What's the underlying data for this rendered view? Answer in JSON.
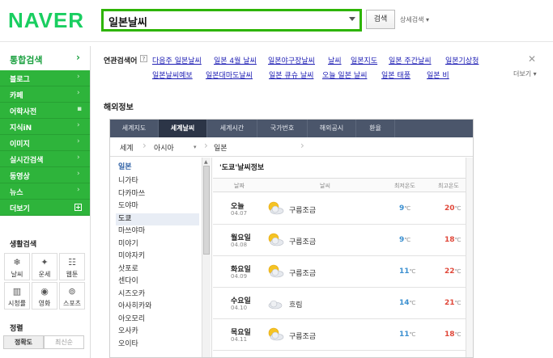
{
  "header": {
    "logo": "NAVER",
    "search_value": "일본날씨",
    "search_button": "검색",
    "detail_search": "상세검색 ▾"
  },
  "sidebar": {
    "top_label": "통합검색",
    "top_arrow": "›",
    "items": [
      {
        "label": "블로그",
        "icon": "chevron-right-icon"
      },
      {
        "label": "카페",
        "icon": "chevron-right-icon"
      },
      {
        "label": "어학사전",
        "icon": "dot-icon"
      },
      {
        "label": "지식iN",
        "icon": "chevron-right-icon"
      },
      {
        "label": "이미지",
        "icon": "chevron-right-icon"
      },
      {
        "label": "실시간검색",
        "icon": "chevron-right-icon"
      },
      {
        "label": "동영상",
        "icon": "chevron-right-icon"
      },
      {
        "label": "뉴스",
        "icon": "chevron-right-icon"
      },
      {
        "label": "더보기",
        "icon": "plus-box-icon"
      }
    ],
    "life_title": "생활검색",
    "life_items": [
      {
        "label": "날씨",
        "glyph": "❄"
      },
      {
        "label": "운세",
        "glyph": "✦"
      },
      {
        "label": "웹툰",
        "glyph": "☷"
      },
      {
        "label": "시청률",
        "glyph": "▥"
      },
      {
        "label": "영화",
        "glyph": "◉"
      },
      {
        "label": "스포츠",
        "glyph": "⊚"
      }
    ],
    "sort_title": "정렬",
    "sort_options": [
      "정확도",
      "최신순"
    ]
  },
  "related": {
    "title": "연관검색어",
    "help": "?",
    "row1": [
      "다음주 일본날씨",
      "일본 4월 날씨",
      "일본야구장날씨",
      "날씨",
      "일본지도",
      "일본 주간날씨",
      "일본기상청"
    ],
    "row2": [
      "일본날씨예보",
      "일본대마도날씨",
      "일본 큐슈 날씨",
      "오늘 일본 날씨",
      "일본 태풍",
      "일본 비"
    ],
    "close": "✕",
    "more": "더보기 ▾"
  },
  "overseas": {
    "section_title": "해외정보",
    "tabs": [
      "세계지도",
      "세계날씨",
      "세계시간",
      "국가번호",
      "해외공시",
      "환율"
    ],
    "active_tab": "세계날씨",
    "crumbs": [
      "세계",
      "아시아",
      "일본"
    ],
    "city_title": "일본",
    "cities": [
      "니가타",
      "다카마쓰",
      "도야마",
      "도쿄",
      "마쓰야마",
      "미야기",
      "미야자키",
      "삿포로",
      "센다이",
      "시즈오카",
      "아사히카와",
      "아오모리",
      "오사카",
      "오이타"
    ],
    "selected_city": "도쿄",
    "weather_title": "'도쿄'날씨정보",
    "weather_headers": [
      "날짜",
      "날씨",
      "최저온도",
      "최고온도"
    ],
    "forecast": [
      {
        "day": "오늘",
        "date": "04.07",
        "condition": "구름조금",
        "icon": "partly-cloudy-icon",
        "min": "9",
        "max": "20"
      },
      {
        "day": "월요일",
        "date": "04.08",
        "condition": "구름조금",
        "icon": "partly-cloudy-icon",
        "min": "9",
        "max": "18"
      },
      {
        "day": "화요일",
        "date": "04.09",
        "condition": "구름조금",
        "icon": "partly-cloudy-icon",
        "min": "11",
        "max": "22"
      },
      {
        "day": "수요일",
        "date": "04.10",
        "condition": "흐림",
        "icon": "cloudy-icon",
        "min": "14",
        "max": "21"
      },
      {
        "day": "목요일",
        "date": "04.11",
        "condition": "구름조금",
        "icon": "partly-cloudy-icon",
        "min": "11",
        "max": "18"
      }
    ],
    "unit": "℃"
  },
  "colors": {
    "brand_green": "#19ce60",
    "sidebar_green": "#2eb43b",
    "tab_bg": "#4b566b",
    "min_temp": "#3a8fd0",
    "max_temp": "#e0483a"
  }
}
